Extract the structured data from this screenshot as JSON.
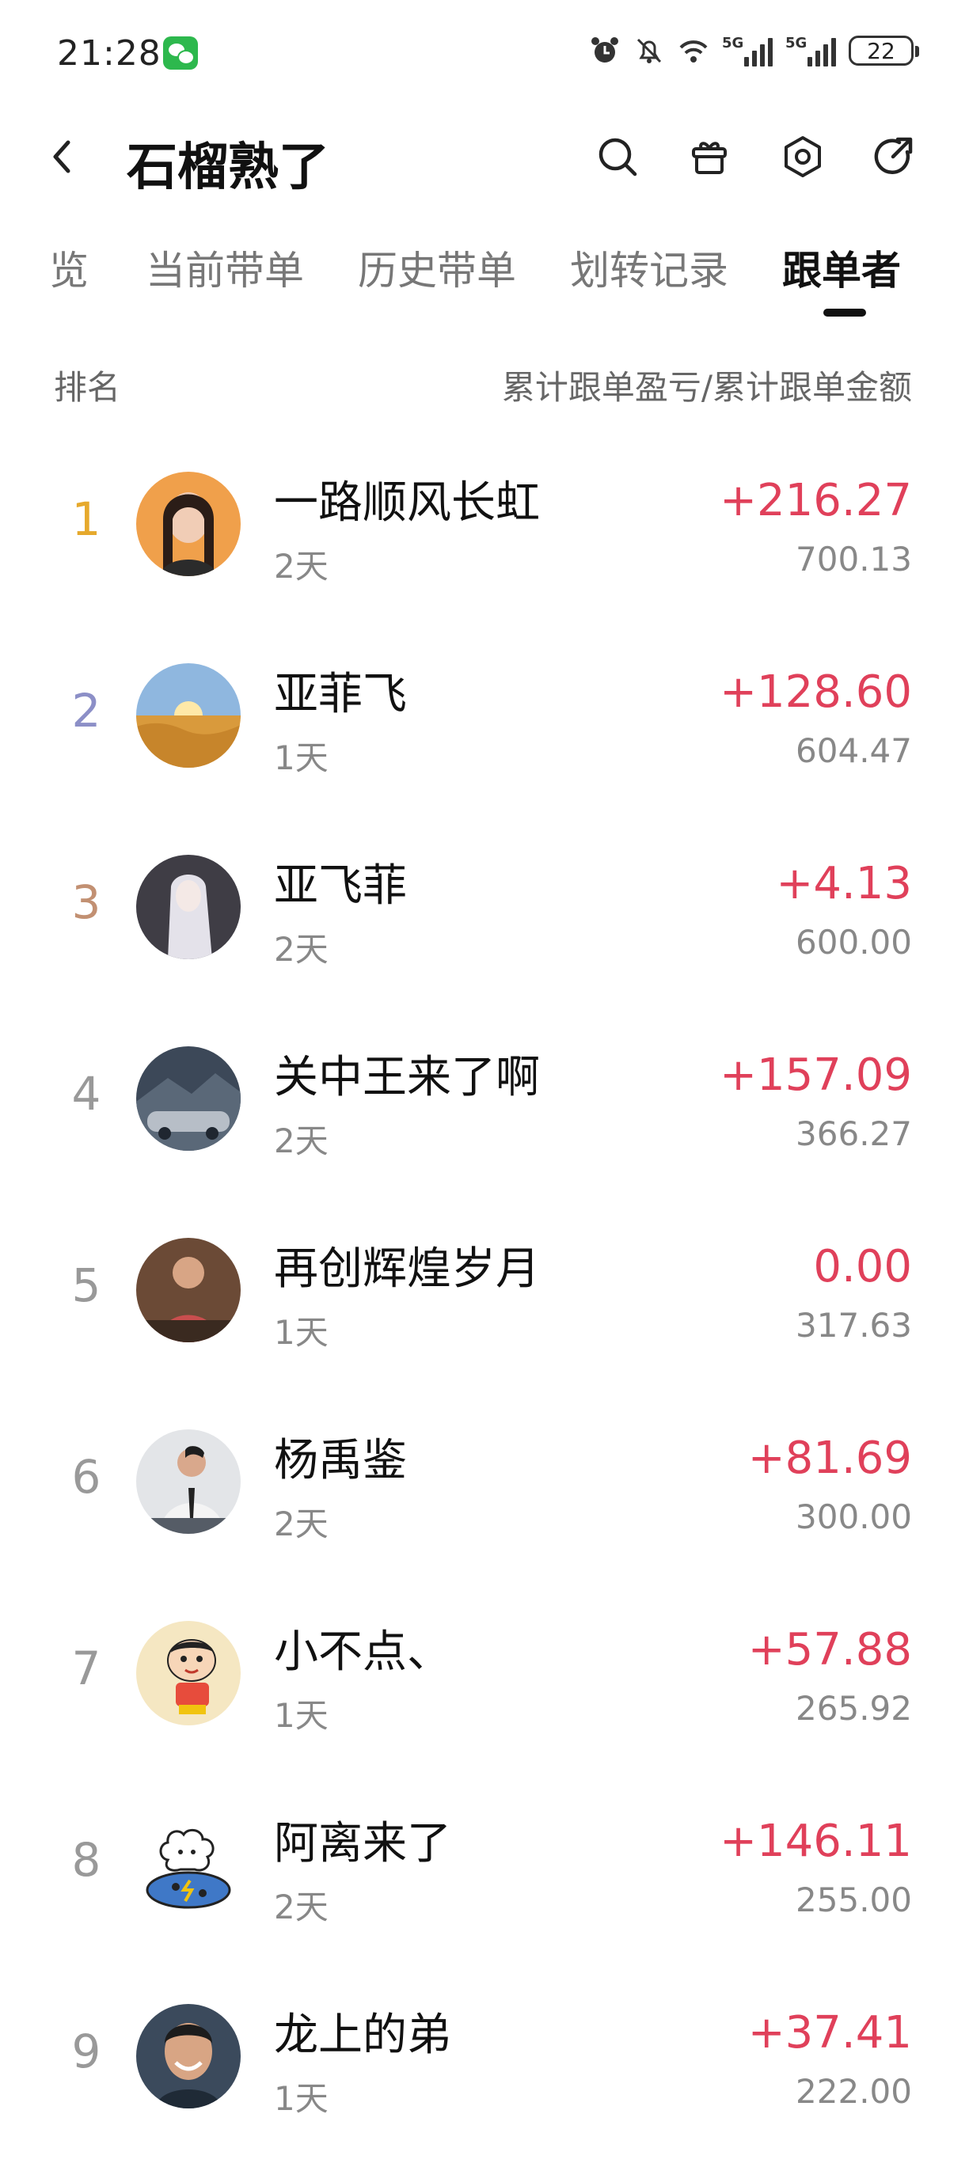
{
  "status_bar": {
    "time": "21:28",
    "battery": "22",
    "signal1": "5G",
    "signal2": "5G"
  },
  "header": {
    "title": "石榴熟了"
  },
  "tabs": [
    {
      "label": "览",
      "active": false
    },
    {
      "label": "当前带单",
      "active": false
    },
    {
      "label": "历史带单",
      "active": false
    },
    {
      "label": "划转记录",
      "active": false
    },
    {
      "label": "跟单者",
      "active": true
    }
  ],
  "columns": {
    "left": "排名",
    "right": "累计跟单盈亏/累计跟单金额"
  },
  "followers": [
    {
      "rank": "1",
      "name": "一路顺风长虹",
      "days": "2天",
      "pnl": "+216.27",
      "amount": "700.13",
      "avatar_color": "#f0a04b"
    },
    {
      "rank": "2",
      "name": "亚菲飞",
      "days": "1天",
      "pnl": "+128.60",
      "amount": "604.47",
      "avatar_color": "#e8b25a"
    },
    {
      "rank": "3",
      "name": "亚飞菲",
      "days": "2天",
      "pnl": "+4.13",
      "amount": "600.00",
      "avatar_color": "#9c9aa6"
    },
    {
      "rank": "4",
      "name": "关中王来了啊",
      "days": "2天",
      "pnl": "+157.09",
      "amount": "366.27",
      "avatar_color": "#4a5766"
    },
    {
      "rank": "5",
      "name": "再创辉煌岁月",
      "days": "1天",
      "pnl": "0.00",
      "amount": "317.63",
      "avatar_color": "#8a5a3c"
    },
    {
      "rank": "6",
      "name": "杨禹鉴",
      "days": "2天",
      "pnl": "+81.69",
      "amount": "300.00",
      "avatar_color": "#cfd3d8"
    },
    {
      "rank": "7",
      "name": "小不点、",
      "days": "1天",
      "pnl": "+57.88",
      "amount": "265.92",
      "avatar_color": "#f5e7c2"
    },
    {
      "rank": "8",
      "name": "阿离来了",
      "days": "2天",
      "pnl": "+146.11",
      "amount": "255.00",
      "avatar_color": "#ffffff"
    },
    {
      "rank": "9",
      "name": "龙上的弟",
      "days": "1天",
      "pnl": "+37.41",
      "amount": "222.00",
      "avatar_color": "#3b4a5c"
    }
  ],
  "colors": {
    "profit": "#e0405a",
    "rank1": "#e6a92c",
    "rank2": "#8c8fc7",
    "rank3": "#c29072",
    "muted": "#888888"
  }
}
